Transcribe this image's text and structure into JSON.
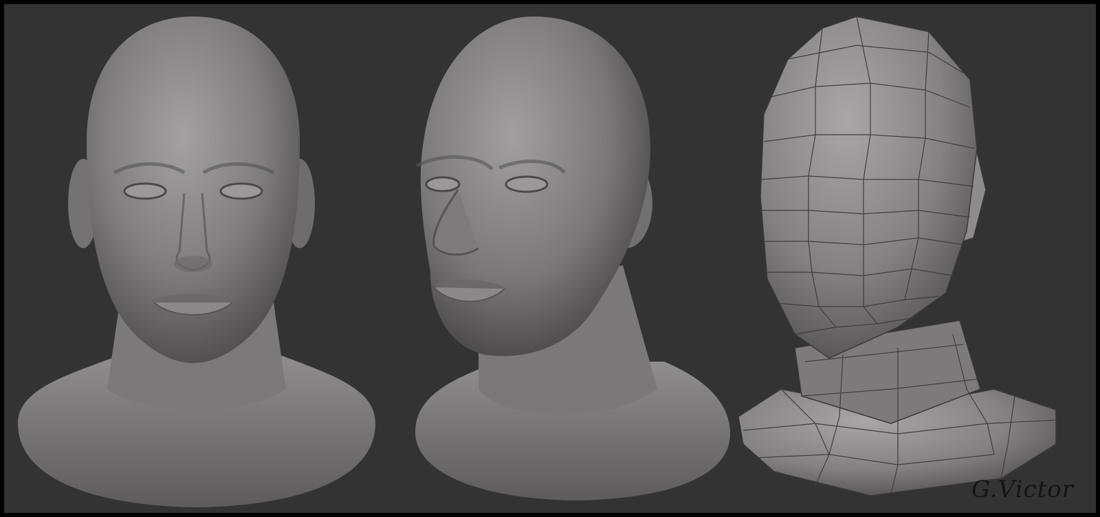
{
  "scene": {
    "description_tag": "three-head-sculpt-render",
    "background_color": "#333333",
    "border_color": "#000000",
    "clay_color": "#8a8888",
    "views": [
      {
        "name": "front-view-sculpt"
      },
      {
        "name": "three-quarter-view-sculpt"
      },
      {
        "name": "low-poly-wireframe-view"
      }
    ]
  },
  "signature": {
    "text": "G.Victor"
  }
}
